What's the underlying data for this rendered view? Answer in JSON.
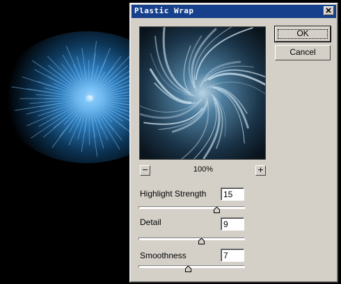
{
  "dialog": {
    "title": "Plastic Wrap",
    "buttons": {
      "ok": "OK",
      "cancel": "Cancel"
    },
    "preview": {
      "zoom_out": "−",
      "zoom_in": "+",
      "zoom_level": "100%"
    },
    "params": [
      {
        "label": "Highlight Strength",
        "value": "15",
        "max": 20
      },
      {
        "label": "Detail",
        "value": "9",
        "max": 15
      },
      {
        "label": "Smoothness",
        "value": "7",
        "max": 15
      }
    ]
  },
  "icons": {
    "close": "close-icon"
  },
  "colors": {
    "titlebar": "#16408c",
    "dialog_bg": "#d4d0c8",
    "canvas": "#000000",
    "burst": "#3a8fd0"
  }
}
